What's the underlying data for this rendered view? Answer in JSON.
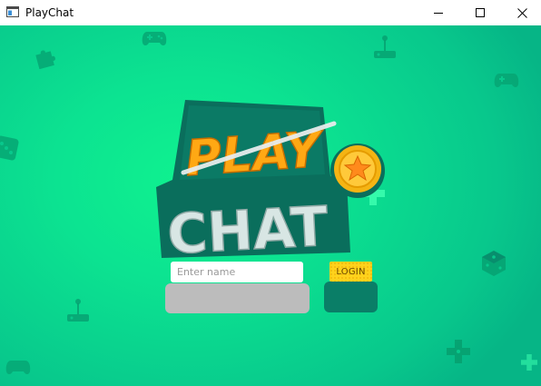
{
  "window": {
    "title": "PlayChat",
    "controls": [
      "minimize",
      "maximize",
      "close"
    ]
  },
  "logo": {
    "line1": "PLAY",
    "line2": "CHAT",
    "badge_icon": "star-icon"
  },
  "login_form": {
    "name_placeholder": "Enter name",
    "name_value": "",
    "login_label": "LOGIN"
  },
  "background_icons": [
    "gamepad-icon",
    "puzzle-icon",
    "joystick-icon",
    "dice-icon",
    "dpad-icon"
  ],
  "colors": {
    "background_light": "#0ff28f",
    "background_dark": "#06b586",
    "logo_dark": "#0a6e5c",
    "play_orange": "#ffa814",
    "chat_light": "#d8e6e4",
    "coin_gold": "#f5b414",
    "login_yellow": "#ffd21c",
    "login_frame": "#0a7e67",
    "input_frame": "#bcbcbc"
  }
}
